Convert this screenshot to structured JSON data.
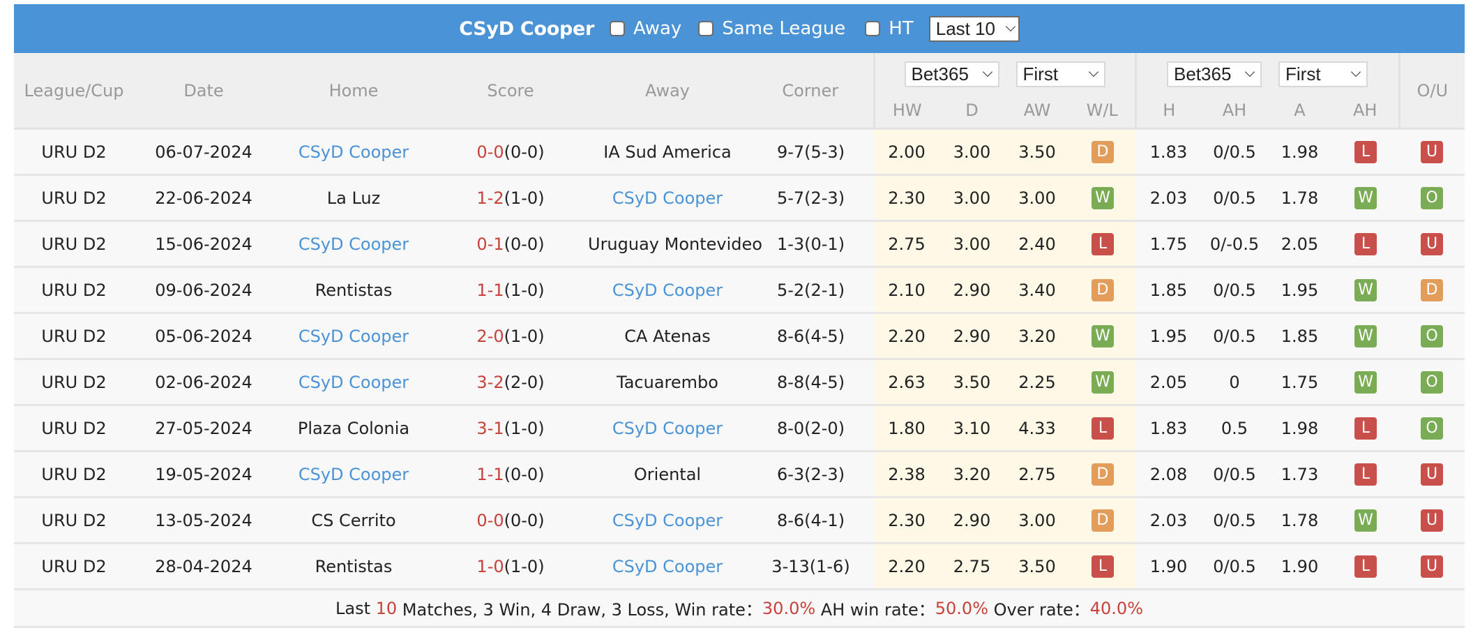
{
  "topbar": {
    "title": "CSyD Cooper",
    "checkboxes": [
      {
        "label": "Away",
        "checked": false
      },
      {
        "label": "Same League",
        "checked": false
      },
      {
        "label": "HT",
        "checked": false
      }
    ],
    "range_select": "Last 10"
  },
  "headers": {
    "league": "League/Cup",
    "date": "Date",
    "home": "Home",
    "score": "Score",
    "away": "Away",
    "corner": "Corner",
    "odds1_company": "Bet365",
    "odds1_type": "First",
    "odds1_cols": [
      "HW",
      "D",
      "AW",
      "W/L"
    ],
    "odds2_company": "Bet365",
    "odds2_type": "First",
    "odds2_cols": [
      "H",
      "AH",
      "A",
      "AH"
    ],
    "ou": "O/U"
  },
  "team": "CSyD Cooper",
  "rows": [
    {
      "league": "URU D2",
      "date": "06-07-2024",
      "home": "CSyD Cooper",
      "ft": "0-0",
      "ht": "(0-0)",
      "away": "IA Sud America",
      "corner": "9-7(5-3)",
      "hw": "2.00",
      "d": "3.00",
      "aw": "3.50",
      "wl": "D",
      "h": "1.83",
      "ah": "0/0.5",
      "a": "1.98",
      "ahr": "L",
      "ou": "U"
    },
    {
      "league": "URU D2",
      "date": "22-06-2024",
      "home": "La Luz",
      "ft": "1-2",
      "ht": "(1-0)",
      "away": "CSyD Cooper",
      "corner": "5-7(2-3)",
      "hw": "2.30",
      "d": "3.00",
      "aw": "3.00",
      "wl": "W",
      "h": "2.03",
      "ah": "0/0.5",
      "a": "1.78",
      "ahr": "W",
      "ou": "O"
    },
    {
      "league": "URU D2",
      "date": "15-06-2024",
      "home": "CSyD Cooper",
      "ft": "0-1",
      "ht": "(0-0)",
      "away": "Uruguay Montevideo",
      "corner": "1-3(0-1)",
      "hw": "2.75",
      "d": "3.00",
      "aw": "2.40",
      "wl": "L",
      "h": "1.75",
      "ah": "0/-0.5",
      "a": "2.05",
      "ahr": "L",
      "ou": "U"
    },
    {
      "league": "URU D2",
      "date": "09-06-2024",
      "home": "Rentistas",
      "ft": "1-1",
      "ht": "(1-0)",
      "away": "CSyD Cooper",
      "corner": "5-2(2-1)",
      "hw": "2.10",
      "d": "2.90",
      "aw": "3.40",
      "wl": "D",
      "h": "1.85",
      "ah": "0/0.5",
      "a": "1.95",
      "ahr": "W",
      "ou": "D"
    },
    {
      "league": "URU D2",
      "date": "05-06-2024",
      "home": "CSyD Cooper",
      "ft": "2-0",
      "ht": "(1-0)",
      "away": "CA Atenas",
      "corner": "8-6(4-5)",
      "hw": "2.20",
      "d": "2.90",
      "aw": "3.20",
      "wl": "W",
      "h": "1.95",
      "ah": "0/0.5",
      "a": "1.85",
      "ahr": "W",
      "ou": "O"
    },
    {
      "league": "URU D2",
      "date": "02-06-2024",
      "home": "CSyD Cooper",
      "ft": "3-2",
      "ht": "(2-0)",
      "away": "Tacuarembo",
      "corner": "8-8(4-5)",
      "hw": "2.63",
      "d": "3.50",
      "aw": "2.25",
      "wl": "W",
      "h": "2.05",
      "ah": "0",
      "a": "1.75",
      "ahr": "W",
      "ou": "O"
    },
    {
      "league": "URU D2",
      "date": "27-05-2024",
      "home": "Plaza Colonia",
      "ft": "3-1",
      "ht": "(1-0)",
      "away": "CSyD Cooper",
      "corner": "8-0(2-0)",
      "hw": "1.80",
      "d": "3.10",
      "aw": "4.33",
      "wl": "L",
      "h": "1.83",
      "ah": "0.5",
      "a": "1.98",
      "ahr": "L",
      "ou": "O"
    },
    {
      "league": "URU D2",
      "date": "19-05-2024",
      "home": "CSyD Cooper",
      "ft": "1-1",
      "ht": "(0-0)",
      "away": "Oriental",
      "corner": "6-3(2-3)",
      "hw": "2.38",
      "d": "3.20",
      "aw": "2.75",
      "wl": "D",
      "h": "2.08",
      "ah": "0/0.5",
      "a": "1.73",
      "ahr": "L",
      "ou": "U"
    },
    {
      "league": "URU D2",
      "date": "13-05-2024",
      "home": "CS Cerrito",
      "ft": "0-0",
      "ht": "(0-0)",
      "away": "CSyD Cooper",
      "corner": "8-6(4-1)",
      "hw": "2.30",
      "d": "2.90",
      "aw": "3.00",
      "wl": "D",
      "h": "2.03",
      "ah": "0/0.5",
      "a": "1.78",
      "ahr": "W",
      "ou": "U"
    },
    {
      "league": "URU D2",
      "date": "28-04-2024",
      "home": "Rentistas",
      "ft": "1-0",
      "ht": "(1-0)",
      "away": "CSyD Cooper",
      "corner": "3-13(1-6)",
      "hw": "2.20",
      "d": "2.75",
      "aw": "3.50",
      "wl": "L",
      "h": "1.90",
      "ah": "0/0.5",
      "a": "1.90",
      "ahr": "L",
      "ou": "U"
    }
  ],
  "footer": {
    "prefix": "Last ",
    "count": "10",
    "summary": " Matches, 3 Win, 4 Draw, 3 Loss, Win rate：",
    "win_rate": "30.0%",
    "ah_label": " AH win rate：",
    "ah_rate": "50.0%",
    "over_label": " Over rate：",
    "over_rate": "40.0%"
  },
  "colors": {
    "header_blue": "#4a93d6",
    "win_green": "#7aab55",
    "loss_red": "#c9504a",
    "draw_orange": "#e39d5b",
    "score_red": "#c9413b",
    "odds_highlight": "#fef9e6"
  }
}
